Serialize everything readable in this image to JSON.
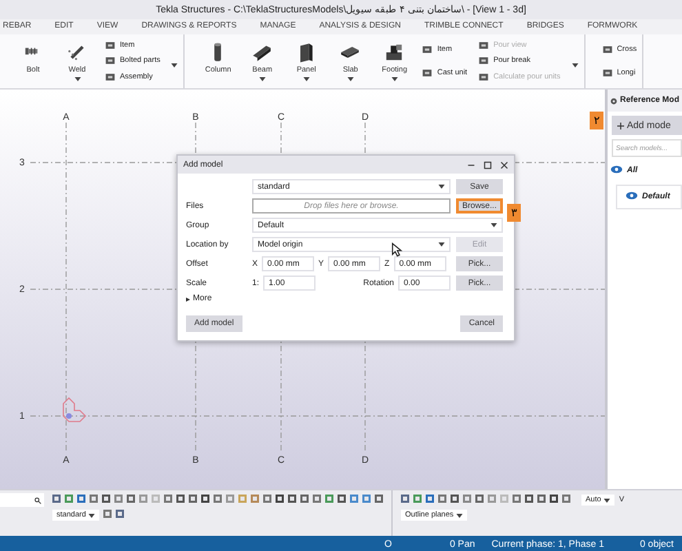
{
  "window": {
    "title": "Tekla Structures - C:\\TeklaStructuresModels\\ساختمان بتنی ۴ طبقه سیویل\\ - [View 1 - 3d]"
  },
  "tabs": [
    {
      "label": "REBAR",
      "selected": false
    },
    {
      "label": "EDIT",
      "selected": false
    },
    {
      "label": "VIEW",
      "selected": false
    },
    {
      "label": "DRAWINGS & REPORTS",
      "selected": false
    },
    {
      "label": "MANAGE",
      "selected": false
    },
    {
      "label": "ANALYSIS & DESIGN",
      "selected": false
    },
    {
      "label": "TRIMBLE CONNECT",
      "selected": false
    },
    {
      "label": "BRIDGES",
      "selected": false
    },
    {
      "label": "FORMWORK",
      "selected": false
    }
  ],
  "ribbon": {
    "groups": [
      {
        "menu": true,
        "items": [
          {
            "kind": "large",
            "label": "Bolt",
            "dropdown": false
          },
          {
            "kind": "large",
            "label": "Weld",
            "dropdown": true
          },
          {
            "kind": "stack",
            "entries": [
              {
                "label": "Item",
                "disabled": false
              },
              {
                "label": "Bolted parts",
                "disabled": false
              },
              {
                "label": "Assembly",
                "disabled": false
              }
            ]
          }
        ]
      },
      {
        "menu": true,
        "items": [
          {
            "kind": "large",
            "label": "Column",
            "dropdown": false
          },
          {
            "kind": "large",
            "label": "Beam",
            "dropdown": true
          },
          {
            "kind": "large",
            "label": "Panel",
            "dropdown": true
          },
          {
            "kind": "large",
            "label": "Slab",
            "dropdown": true
          },
          {
            "kind": "large",
            "label": "Footing",
            "dropdown": true
          },
          {
            "kind": "stack",
            "entries": [
              {
                "label": "Item",
                "disabled": false
              },
              {
                "label": "Cast unit",
                "disabled": false
              }
            ]
          },
          {
            "kind": "stack",
            "entries": [
              {
                "label": "Pour view",
                "disabled": true
              },
              {
                "label": "Pour break",
                "disabled": false
              },
              {
                "label": "Calculate pour units",
                "disabled": true
              }
            ]
          }
        ]
      },
      {
        "menu": false,
        "items": [
          {
            "kind": "stack",
            "entries": [
              {
                "label": "Cross",
                "disabled": false
              },
              {
                "label": "Longi",
                "disabled": false
              }
            ]
          }
        ]
      }
    ]
  },
  "grid": {
    "columns": [
      {
        "top": "A",
        "bottom": "A"
      },
      {
        "top": "B",
        "bottom": "B"
      },
      {
        "top": "C",
        "bottom": "C"
      },
      {
        "top": "D",
        "bottom": "D"
      }
    ],
    "rows": [
      {
        "label": "3"
      },
      {
        "label": "2"
      },
      {
        "label": "1"
      }
    ]
  },
  "dialog": {
    "title": "Add model",
    "preset": "standard",
    "save": "Save",
    "files": {
      "label": "Files",
      "placeholder": "Drop files here or browse.",
      "button": "Browse...",
      "highlighted": true
    },
    "group": {
      "label": "Group",
      "value": "Default"
    },
    "location": {
      "label": "Location by",
      "value": "Model origin",
      "button": "Edit",
      "button_disabled": true
    },
    "offset": {
      "label": "Offset",
      "fields": [
        {
          "axis": "X",
          "value": "0.00 mm"
        },
        {
          "axis": "Y",
          "value": "0.00 mm"
        },
        {
          "axis": "Z",
          "value": "0.00 mm"
        }
      ],
      "button": "Pick..."
    },
    "scale": {
      "label": "Scale",
      "prefix": "1:",
      "value": "1.00",
      "rotation_label": "Rotation",
      "rotation": "0.00",
      "button": "Pick..."
    },
    "more": {
      "label": "More",
      "expanded": false
    },
    "add": "Add model",
    "cancel": "Cancel"
  },
  "callouts": [
    {
      "label": "۲"
    },
    {
      "label": "۳"
    }
  ],
  "reference_panel": {
    "title": "Reference Mod",
    "add": "Add mode",
    "search": {
      "placeholder": "Search models..."
    },
    "items": [
      {
        "label": "All",
        "visible": true
      },
      {
        "label": "Default",
        "visible": true
      }
    ]
  },
  "bottom_toolbar": {
    "preset": "standard",
    "planes": "Outline planes",
    "auto": "Auto",
    "cut_label": "V"
  },
  "status_bar": {
    "items": [
      "O",
      "0 Pan",
      "Current phase: 1, Phase 1",
      "0 object"
    ]
  }
}
